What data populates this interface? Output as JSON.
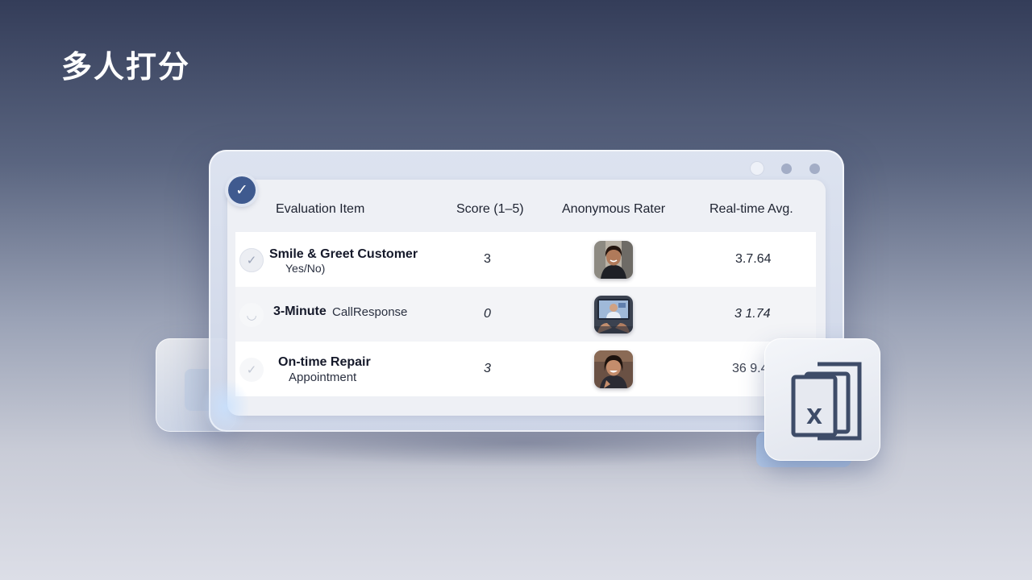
{
  "page": {
    "title": "多人打分"
  },
  "table": {
    "headers": [
      "Evaluation Item",
      "Score (1–5)",
      "Anonymous Rater",
      "Real-time Avg."
    ],
    "rows": [
      {
        "title": "Smile & Greet Customer",
        "subtitle": "Yes/No)",
        "score": "3",
        "rater_photo": "rater-photo-woman-smiling",
        "avg": "3.7.64"
      },
      {
        "title": "3-Minute",
        "title_tail": "CallResponse",
        "subtitle": "",
        "score": "0",
        "rater_photo": "rater-photo-video-call",
        "avg": "3 1.74"
      },
      {
        "title": "On-time Repair",
        "subtitle": "Appointment",
        "score": "3",
        "rater_photo": "rater-photo-woman-laughing",
        "avg": "36 9.4"
      }
    ]
  },
  "icons": {
    "badge": "check-circle-icon",
    "row_check": "check-icon",
    "export": "excel-file-icon",
    "export_letter": "X"
  },
  "colors": {
    "accent": "#3f5a8f",
    "icon_stroke": "#3e4c68"
  }
}
